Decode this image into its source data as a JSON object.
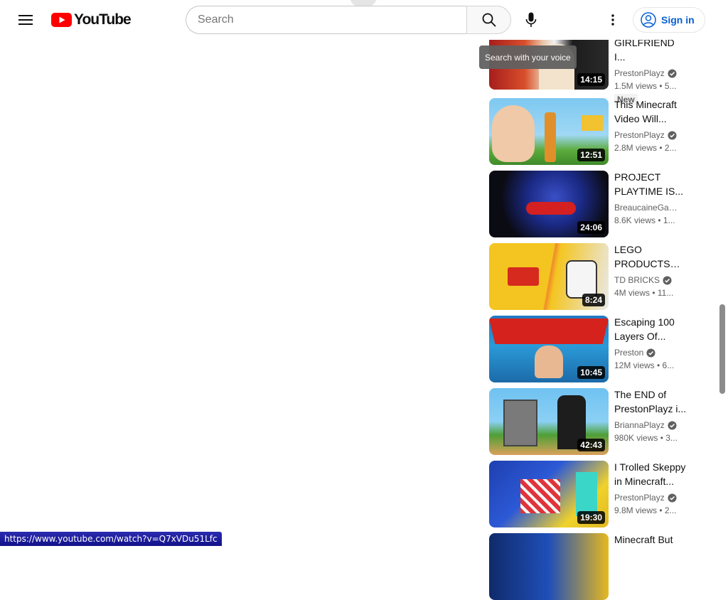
{
  "header": {
    "logo_text": "YouTube",
    "search_placeholder": "Search",
    "signin_label": "Sign in",
    "voice_tooltip": "Search with your voice"
  },
  "colors": {
    "brand_red": "#ff0000",
    "link_blue": "#065fd4"
  },
  "related": [
    {
      "title": "GIRLFRIEND I...",
      "channel": "PrestonPlayz",
      "verified": true,
      "stats": "1.5M views  •  5...",
      "duration": "14:15",
      "badge": "New"
    },
    {
      "title": "This Minecraft Video Will...",
      "channel": "PrestonPlayz",
      "verified": true,
      "stats": "2.8M views  •  2...",
      "duration": "12:51"
    },
    {
      "title": "PROJECT PLAYTIME IS...",
      "channel": "BreaucaineGami...",
      "verified": false,
      "stats": "8.6K views  •  1...",
      "duration": "24:06"
    },
    {
      "title": "LEGO PRODUCTS yo...",
      "channel": "TD BRICKS",
      "verified": true,
      "stats": "4M views  •  11...",
      "duration": "8:24"
    },
    {
      "title": "Escaping 100 Layers Of...",
      "channel": "Preston",
      "verified": true,
      "stats": "12M views  •  6...",
      "duration": "10:45"
    },
    {
      "title": "The END of PrestonPlayz i...",
      "channel": "BriannaPlayz",
      "verified": true,
      "stats": "980K views  •  3...",
      "duration": "42:43"
    },
    {
      "title": "I Trolled Skeppy in Minecraft...",
      "channel": "PrestonPlayz",
      "verified": true,
      "stats": "9.8M views  •  2...",
      "duration": "19:30"
    },
    {
      "title": "Minecraft But",
      "channel": "",
      "verified": false,
      "stats": "",
      "duration": ""
    }
  ],
  "status_url": "https://www.youtube.com/watch?v=Q7xVDu51Lfc"
}
